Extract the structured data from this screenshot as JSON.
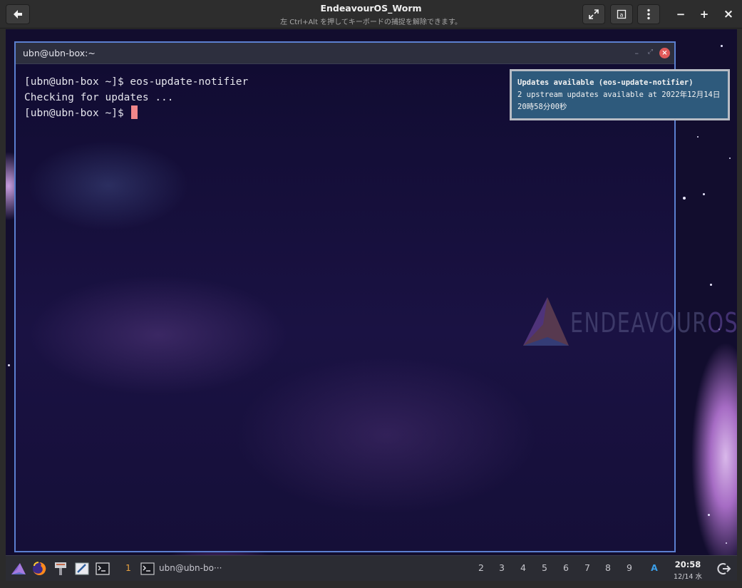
{
  "viewer": {
    "title": "EndeavourOS_Worm",
    "subtitle": "左 Ctrl+Alt を押してキーボードの捕捉を解除できます。",
    "buttons": {
      "back": "back-arrow-icon",
      "fullscreen": "expand-icon",
      "screenshot": "screenshot-icon",
      "menu": "kebab-menu-icon",
      "minimize_label": "−",
      "maximize_label": "+",
      "close_label": "×"
    }
  },
  "terminal": {
    "title": "ubn@ubn-box:~",
    "lines": [
      "[ubn@ubn-box ~]$ eos-update-notifier",
      "Checking for updates ...",
      "[ubn@ubn-box ~]$ "
    ],
    "controls": {
      "minimize": "–",
      "restore": "⤢",
      "close": "×"
    },
    "border_color": "#5b7fd0"
  },
  "watermark": {
    "brand": "ENDEAVOUR",
    "brand_suffix": "OS"
  },
  "notification": {
    "title": "Updates available (eos-update-notifier)",
    "body": "2 upstream updates available at 2022年12月14日 20時58分00秒"
  },
  "panel": {
    "launchers": [
      "endeavouros-menu-icon",
      "firefox-icon",
      "file-manager-icon",
      "text-editor-icon",
      "terminal-icon"
    ],
    "active_workspace": "1",
    "task_label": "ubn@ubn-bo···",
    "workspaces": [
      "2",
      "3",
      "4",
      "5",
      "6",
      "7",
      "8",
      "9"
    ],
    "keyboard_indicator": "A",
    "clock": {
      "time": "20:58",
      "date": "12/14 水"
    },
    "logout_icon": "logout-icon"
  }
}
